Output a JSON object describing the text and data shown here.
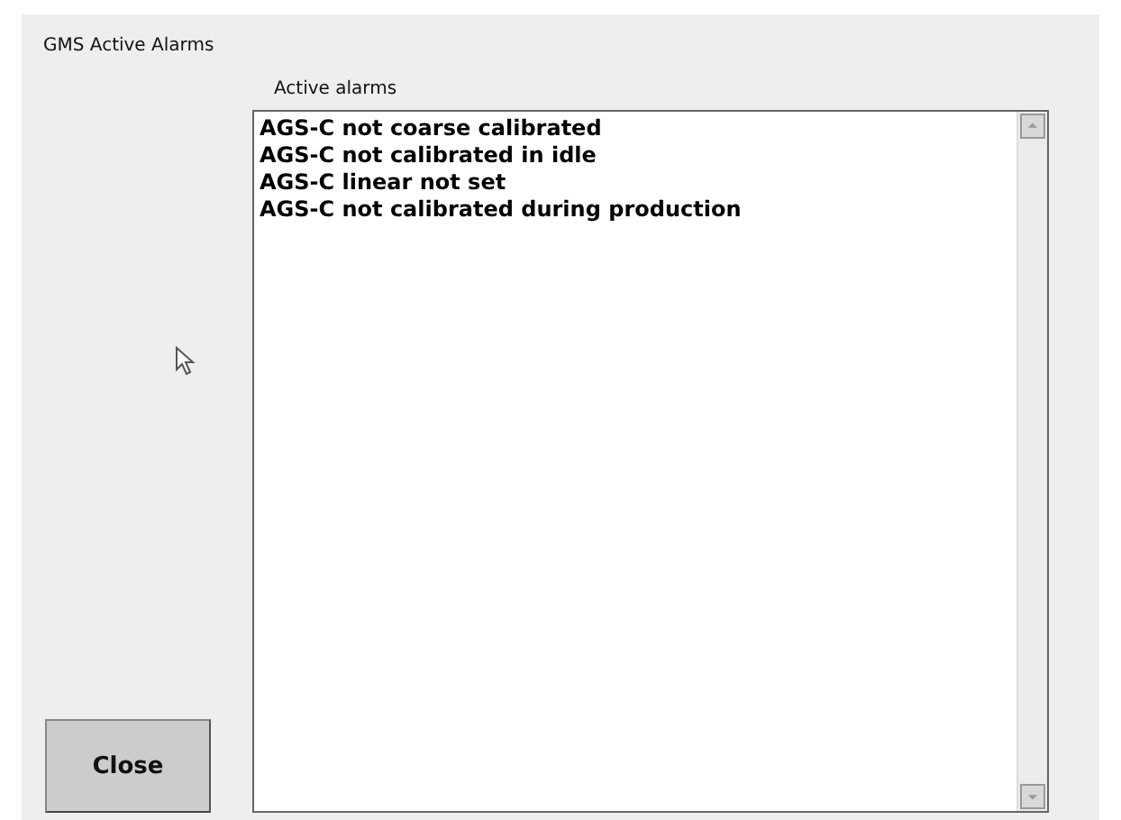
{
  "window": {
    "title": "GMS Active Alarms"
  },
  "list": {
    "label": "Active alarms",
    "items": [
      {
        "text": "AGS-C not coarse calibrated"
      },
      {
        "text": "AGS-C not calibrated in idle"
      },
      {
        "text": "AGS-C linear not set"
      },
      {
        "text": "AGS-C not calibrated during production"
      }
    ]
  },
  "buttons": [
    {
      "label": "Close"
    }
  ]
}
